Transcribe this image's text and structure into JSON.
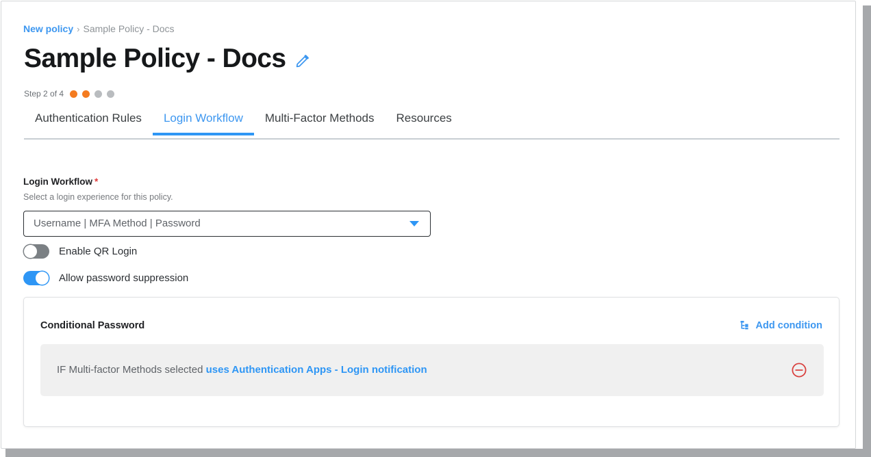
{
  "breadcrumb": {
    "link_label": "New policy",
    "separator": "›",
    "current_label": "Sample Policy - Docs"
  },
  "header": {
    "title": "Sample Policy - Docs",
    "edit_icon": "pencil-icon"
  },
  "stepper": {
    "label": "Step 2 of 4",
    "current_step": 2,
    "total_steps": 4,
    "active_color": "#f47b20",
    "inactive_color": "#b9bcbf"
  },
  "tabs": [
    {
      "label": "Authentication Rules",
      "active": false
    },
    {
      "label": "Login Workflow",
      "active": true
    },
    {
      "label": "Multi-Factor Methods",
      "active": false
    },
    {
      "label": "Resources",
      "active": false
    }
  ],
  "field": {
    "label": "Login Workflow",
    "required_marker": "*",
    "help_text": "Select a login experience for this policy.",
    "select_value": "Username | MFA Method | Password",
    "caret_icon": "chevron-down-icon"
  },
  "toggles": [
    {
      "label": "Enable QR Login",
      "state": "off"
    },
    {
      "label": "Allow password suppression",
      "state": "on"
    }
  ],
  "card": {
    "title": "Conditional Password",
    "add_condition_label": "Add condition",
    "add_condition_icon": "hierarchy-icon",
    "condition": {
      "prefix_text": "IF Multi-factor Methods selected ",
      "link_text": "uses Authentication Apps - Login notification",
      "remove_icon": "minus-circle-icon"
    }
  },
  "colors": {
    "accent_blue": "#2e96f5",
    "link_blue": "#3d97f0",
    "step_orange": "#f47b20",
    "danger_red": "#d9413f",
    "row_gray": "#f0f0f0"
  }
}
